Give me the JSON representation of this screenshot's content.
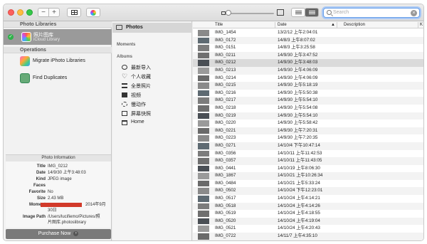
{
  "toolbar": {
    "zoom_out_label": "−",
    "zoom_in_label": "+",
    "search_placeholder": "Search",
    "search_clear": "×"
  },
  "sidebar": {
    "photo_libraries_header": "Photo Libraries",
    "library": {
      "name": "照片图库",
      "subtitle": "iCloud Library"
    },
    "operations_header": "Operations",
    "operations": [
      {
        "label": "Migrate iPhoto Libraries",
        "icon": "iphoto-icon"
      },
      {
        "label": "Find Duplicates",
        "icon": "duplicates-icon"
      }
    ]
  },
  "info": {
    "header": "Photo Information",
    "rows": [
      {
        "key": "Title",
        "value": "IMG_0212"
      },
      {
        "key": "Date",
        "value": "14/9/30 上午3:48:03"
      },
      {
        "key": "Kind",
        "value": "JPEG image"
      },
      {
        "key": "Faces",
        "value": ""
      },
      {
        "key": "Favorite",
        "value": "No"
      },
      {
        "key": "Size",
        "value": "2.43 MB"
      }
    ],
    "moment_key": "Moment",
    "moment_value": "2014年9月",
    "moment_value_2": "30日",
    "image_path_key": "Image Path",
    "image_path_value": "/Users/lucifiemo/Pictures/照",
    "image_path_value_2": "片图库.photoslibrary",
    "purchase_label": "Purchase Now",
    "purchase_chevron": "›"
  },
  "albums": {
    "photos_label": "Photos",
    "moments_header": "Moments",
    "albums_header": "Albums",
    "items": [
      {
        "label": "最新导入",
        "icon": "recent-import-icon"
      },
      {
        "label": "个人收藏",
        "icon": "heart-icon"
      },
      {
        "label": "全景照片",
        "icon": "panorama-icon"
      },
      {
        "label": "视频",
        "icon": "video-icon"
      },
      {
        "label": "慢动作",
        "icon": "slow-motion-icon"
      },
      {
        "label": "屏幕快照",
        "icon": "screenshot-icon"
      },
      {
        "label": "Home",
        "icon": "album-icon"
      }
    ]
  },
  "list": {
    "columns": [
      "Title",
      "Date",
      "Description"
    ],
    "sort_indicator": "▲",
    "edge_label": "K",
    "selected_title": "IMG_0212",
    "rows": [
      {
        "title": "IMG_1454",
        "date": "13/2/12 上午2:04:01"
      },
      {
        "title": "IMG_0172",
        "date": "14/8/3 上午8:07:02"
      },
      {
        "title": "IMG_0151",
        "date": "14/8/3 上午3:25:58"
      },
      {
        "title": "IMG_0211",
        "date": "14/9/30 上午3:47:52"
      },
      {
        "title": "IMG_0212",
        "date": "14/9/30 上午3:48:03"
      },
      {
        "title": "IMG_0213",
        "date": "14/9/30 上午4:06:09"
      },
      {
        "title": "IMG_0214",
        "date": "14/9/30 上午4:06:09"
      },
      {
        "title": "IMG_0215",
        "date": "14/9/30 上午5:18:19"
      },
      {
        "title": "IMG_0216",
        "date": "14/9/30 上午5:50:38"
      },
      {
        "title": "IMG_0217",
        "date": "14/9/30 上午5:54:10"
      },
      {
        "title": "IMG_0218",
        "date": "14/9/30 上午5:54:08"
      },
      {
        "title": "IMG_0219",
        "date": "14/9/30 上午5:54:10"
      },
      {
        "title": "IMG_0220",
        "date": "14/9/30 上午5:58:42"
      },
      {
        "title": "IMG_0221",
        "date": "14/9/30 上午7:20:31"
      },
      {
        "title": "IMG_0223",
        "date": "14/9/30 上午7:20:35"
      },
      {
        "title": "IMG_0271",
        "date": "14/10/4 下午10:47:14"
      },
      {
        "title": "IMG_0356",
        "date": "14/10/11 上午11:42:53"
      },
      {
        "title": "IMG_0357",
        "date": "14/10/11 上午11:43:05"
      },
      {
        "title": "IMG_0441",
        "date": "14/10/19 上午8:06:30"
      },
      {
        "title": "IMG_1867",
        "date": "14/10/21 上午10:26:34"
      },
      {
        "title": "IMG_0484",
        "date": "14/10/21 上午5:33:24"
      },
      {
        "title": "IMG_0502",
        "date": "14/10/24 下午12:23:01"
      },
      {
        "title": "IMG_0517",
        "date": "14/10/24 上午4:14:21"
      },
      {
        "title": "IMG_0518",
        "date": "14/10/24 上午4:14:26"
      },
      {
        "title": "IMG_0519",
        "date": "14/10/24 上午4:18:55"
      },
      {
        "title": "IMG_0520",
        "date": "14/10/24 上午4:19:04"
      },
      {
        "title": "IMG_0521",
        "date": "14/10/24 上午4:20:43"
      },
      {
        "title": "IMG_0722",
        "date": "14/11/7 上午4:35:10"
      }
    ]
  },
  "colors": {
    "selection": "#dadada",
    "library_selected": "#9a9a9a",
    "redaction": "#d23a2a",
    "check": "#2fb14a"
  }
}
